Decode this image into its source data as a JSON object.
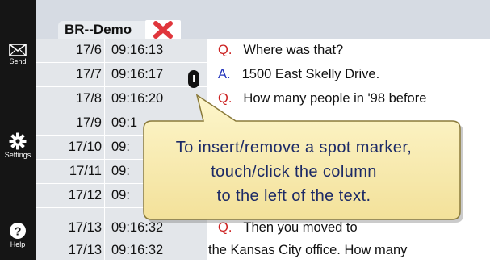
{
  "sidebar": {
    "send_label": "Send",
    "settings_label": "Settings",
    "help_label": "Help"
  },
  "tab": {
    "title": "BR--Demo"
  },
  "rows": [
    {
      "page": "17/6",
      "time": "09:16:13",
      "prefix": "Q.",
      "prefix_color": "#cc2222",
      "text": "Where was that?"
    },
    {
      "page": "17/7",
      "time": "09:16:17",
      "prefix": "A.",
      "prefix_color": "#2233bb",
      "text": "1500 East Skelly Drive."
    },
    {
      "page": "17/8",
      "time": "09:16:20",
      "prefix": "Q.",
      "prefix_color": "#cc2222",
      "text": "How many people in '98 before"
    },
    {
      "page": "17/9",
      "time": "09:1",
      "prefix": "",
      "prefix_color": "#cc2222",
      "text": ""
    },
    {
      "page": "17/10",
      "time": "09:",
      "prefix": "",
      "prefix_color": "#cc2222",
      "text": ""
    },
    {
      "page": "17/11",
      "time": "09:",
      "prefix": "",
      "prefix_color": "#cc2222",
      "text": ""
    },
    {
      "page": "17/12",
      "time": "09:",
      "prefix": "",
      "prefix_color": "#cc2222",
      "text": ""
    },
    {
      "page": "17/13",
      "time": "09:16:32",
      "prefix": "Q.",
      "prefix_color": "#cc2222",
      "text": "Then you moved to"
    },
    {
      "page": "17/13",
      "time": "09:16:32",
      "prefix": "",
      "prefix_color": "#cc2222",
      "text": "the Kansas City office.  How many"
    }
  ],
  "marker": {
    "glyph": "I"
  },
  "callout": {
    "line1": "To insert/remove a spot marker,",
    "line2": "touch/click the column",
    "line3": "to the left of the text."
  },
  "colors": {
    "sidebar_bg": "#151515",
    "time_col_bg": "#e3e6ea",
    "callout_fill": "#fbf1b8",
    "callout_text": "#1c2a66",
    "close_red": "#e0363c"
  }
}
